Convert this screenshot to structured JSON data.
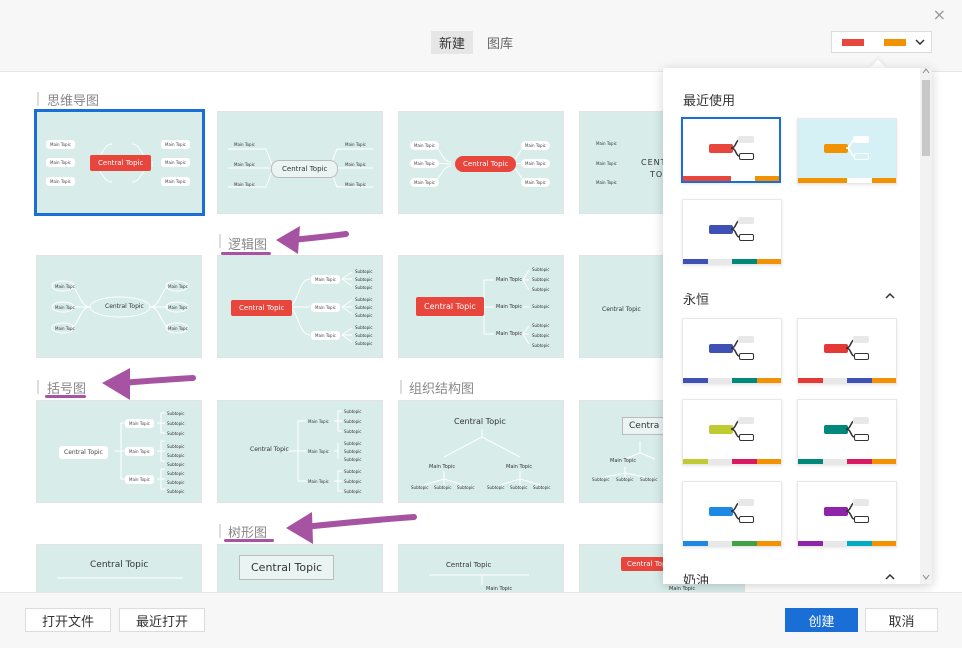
{
  "top": {
    "close_label": "×",
    "tabs": [
      {
        "label": "新建",
        "active": true
      },
      {
        "label": "图库",
        "active": false
      }
    ],
    "theme_colors": [
      "#e8453c",
      "#f39200"
    ],
    "theme_chevron": "⌄"
  },
  "sections": {
    "mindmap": "思维导图",
    "logic": "逻辑图",
    "bracket": "括号图",
    "org": "组织结构图",
    "tree": "树形图"
  },
  "cards": {
    "central_topic": "Central Topic",
    "main_topic": "Main Topic",
    "main_topic_short": "Main Topc",
    "subtopic": "Subtopic",
    "subtopic_short": "Subtopic",
    "central_partial": "CENT",
    "central_partial2": "TO",
    "centra": "Centra"
  },
  "panel": {
    "recent_title": "最近使用",
    "eternal_title": "永恒",
    "cream_title": "奶油",
    "collapse_icon": "︿",
    "recent_swatches": [
      {
        "pill": "#e8453c",
        "stripe": [
          "#e8453c",
          "#e8453c",
          "#ffffff",
          "#f39200"
        ],
        "bg": "#ffffff",
        "selected": true
      },
      {
        "pill": "#f39200",
        "stripe": [
          "#f39200",
          "#f39200",
          "#ffffff",
          "#f39200"
        ],
        "bg": "#d6f1f6",
        "selected": false
      },
      {
        "pill": "#3f51b5",
        "stripe": [
          "#3f51b5",
          "#e8e8e8",
          "#00897b",
          "#f39200"
        ],
        "bg": "#ffffff",
        "selected": false
      }
    ],
    "eternal_swatches": [
      {
        "pill": "#3f51b5",
        "stripe": [
          "#3f51b5",
          "#e8e8e8",
          "#00897b",
          "#f39200"
        ]
      },
      {
        "pill": "#e53935",
        "stripe": [
          "#e53935",
          "#e8e8e8",
          "#3f51b5",
          "#f39200"
        ]
      },
      {
        "pill": "#c0ca33",
        "stripe": [
          "#c0ca33",
          "#e8e8e8",
          "#d81b60",
          "#f39200"
        ]
      },
      {
        "pill": "#00897b",
        "stripe": [
          "#00897b",
          "#e8e8e8",
          "#d81b60",
          "#f39200"
        ]
      },
      {
        "pill": "#1e88e5",
        "stripe": [
          "#1e88e5",
          "#e8e8e8",
          "#43a047",
          "#f39200"
        ]
      },
      {
        "pill": "#8e24aa",
        "stripe": [
          "#8e24aa",
          "#e8e8e8",
          "#00acc1",
          "#f39200"
        ]
      }
    ]
  },
  "bottom": {
    "open_file": "打开文件",
    "recent_open": "最近打开",
    "create": "创建",
    "cancel": "取消"
  },
  "colors": {
    "accent": "#1a6fd6",
    "annotation": "#a653a2",
    "card_bg": "#d8ecea",
    "topic_red": "#e8453c"
  }
}
